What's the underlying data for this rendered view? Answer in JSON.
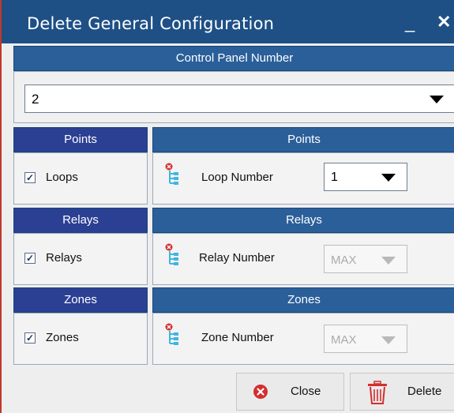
{
  "window": {
    "title": "Delete General Configuration",
    "min_glyph": "_",
    "close_glyph": "✕"
  },
  "control_panel": {
    "header": "Control Panel Number",
    "value": "2"
  },
  "points": {
    "left_header": "Points",
    "checkbox_label": "Loops",
    "checked": true,
    "right_header": "Points",
    "field_label": "Loop Number",
    "value": "1"
  },
  "relays": {
    "left_header": "Relays",
    "checkbox_label": "Relays",
    "checked": true,
    "right_header": "Relays",
    "field_label": "Relay Number",
    "value": "MAX"
  },
  "zones": {
    "left_header": "Zones",
    "checkbox_label": "Zones",
    "checked": true,
    "right_header": "Zones",
    "field_label": "Zone Number",
    "value": "MAX"
  },
  "buttons": {
    "close": "Close",
    "delete": "Delete"
  },
  "colors": {
    "title_bar": "#1e5086",
    "header": "#2a5f9a",
    "left_header": "#2b3f93",
    "close_icon": "#d32f2f"
  },
  "icons": {
    "tree": "tree-structure-icon",
    "close": "close-circle-icon",
    "delete": "trash-icon"
  }
}
